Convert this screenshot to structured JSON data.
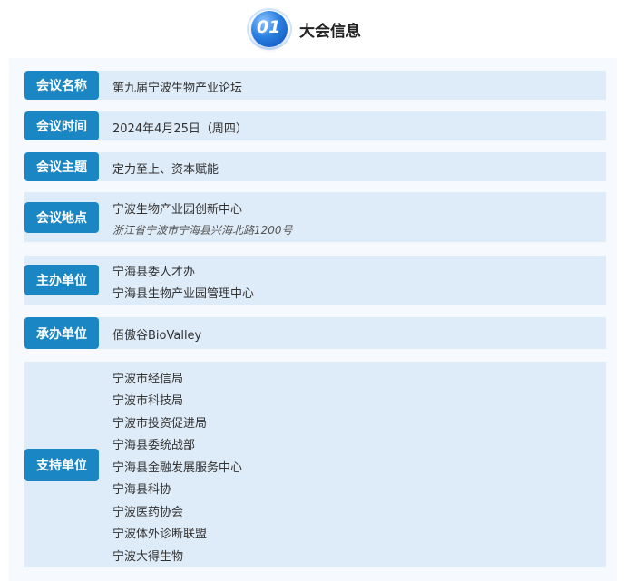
{
  "header": {
    "badge_number": "01",
    "title": "大会信息"
  },
  "rows": {
    "name": {
      "label": "会议名称",
      "values": [
        "第九届宁波生物产业论坛"
      ]
    },
    "time": {
      "label": "会议时间",
      "values": [
        "2024年4月25日（周四）"
      ]
    },
    "theme": {
      "label": "会议主题",
      "values": [
        "定力至上、资本赋能"
      ]
    },
    "venue": {
      "label": "会议地点",
      "values": [
        "宁波生物产业园创新中心",
        "浙江省宁波市宁海县兴海北路1200号"
      ]
    },
    "host": {
      "label": "主办单位",
      "values": [
        "宁海县委人才办",
        "宁海县生物产业园管理中心"
      ]
    },
    "organizer": {
      "label": "承办单位",
      "values": [
        "佰傲谷BioValley"
      ]
    },
    "support": {
      "label": "支持单位",
      "values": [
        "宁波市经信局",
        "宁波市科技局",
        "宁波市投资促进局",
        "宁海县委统战部",
        "宁海县金融发展服务中心",
        "宁海县科协",
        "宁波医药协会",
        "宁波体外诊断联盟",
        "宁波大得生物"
      ]
    }
  },
  "colors": {
    "label_bg": "#1b86c4",
    "row_bg": "#deebf8",
    "badge": "#2a7fe0"
  }
}
